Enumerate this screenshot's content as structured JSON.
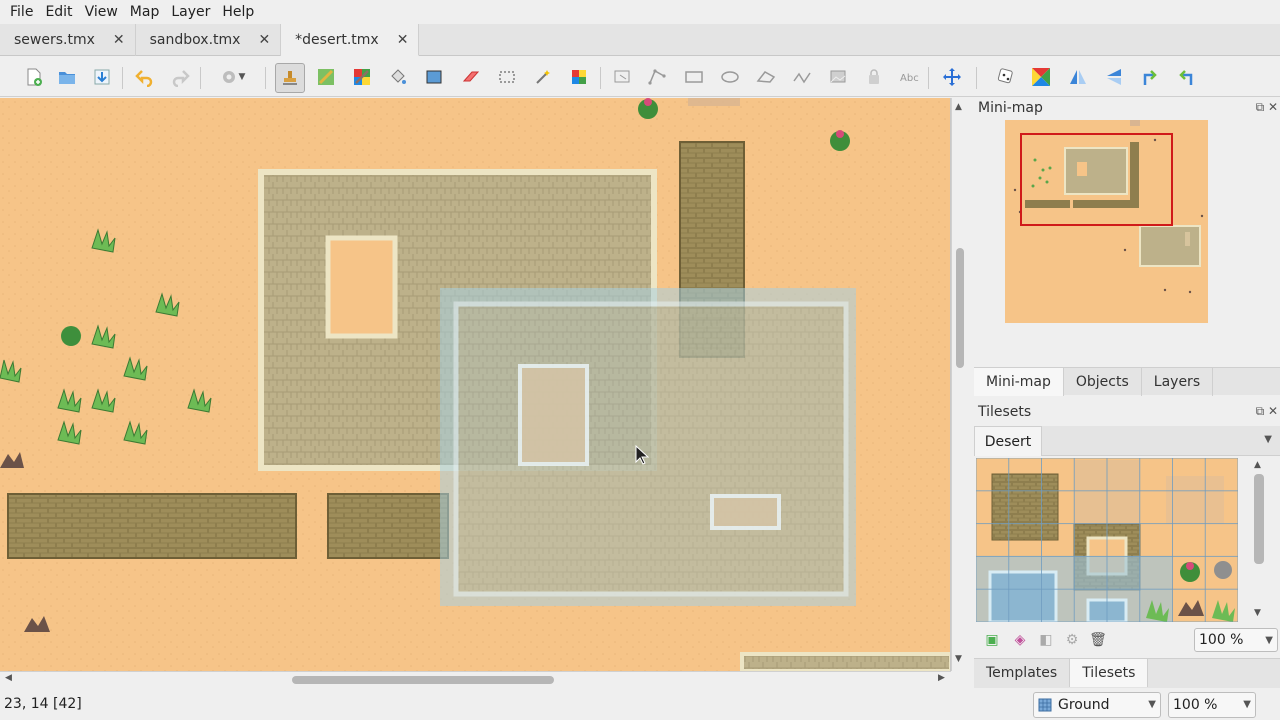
{
  "menu": [
    "File",
    "Edit",
    "View",
    "Map",
    "Layer",
    "Help"
  ],
  "tabs": [
    {
      "label": "sewers.tmx",
      "active": false
    },
    {
      "label": "sandbox.tmx",
      "active": false
    },
    {
      "label": "*desert.tmx",
      "active": true
    }
  ],
  "tab_close_glyph": "✕",
  "toolbar_icons": [
    "new-map-icon",
    "open-icon",
    "save-icon",
    "undo-icon",
    "redo-icon",
    "command-icon",
    "stamp-brush-icon",
    "terrain-brush-icon",
    "wang-brush-icon",
    "bucket-fill-icon",
    "shape-fill-icon",
    "eraser-icon",
    "rect-select-icon",
    "magic-wand-icon",
    "select-same-tile-icon",
    "select-objects-icon",
    "edit-polygons-icon",
    "insert-rectangle-icon",
    "insert-ellipse-icon",
    "insert-polygon-icon",
    "insert-polyline-icon",
    "insert-tile-icon",
    "insert-template-icon",
    "insert-text-icon",
    "move-icon",
    "random-mode-icon",
    "wang-fill-mode-icon",
    "flip-horizontal-icon",
    "flip-vertical-icon",
    "rotate-left-icon",
    "rotate-right-icon"
  ],
  "status": {
    "coords": "23, 14 [42]",
    "layer": "Ground",
    "zoom": "100 %"
  },
  "minimap": {
    "title": "Mini-map"
  },
  "dock_tabs_top": [
    {
      "label": "Mini-map",
      "active": true
    },
    {
      "label": "Objects",
      "active": false
    },
    {
      "label": "Layers",
      "active": false
    }
  ],
  "tilesets": {
    "title": "Tilesets",
    "tab": "Desert",
    "zoom": "100 %"
  },
  "dock_tabs_bottom": [
    {
      "label": "Templates",
      "active": false
    },
    {
      "label": "Tilesets",
      "active": true
    }
  ],
  "colors": {
    "sand": "#f6c488",
    "stone_floor": "#c2b58e",
    "stone_border": "#ede5c4",
    "brick": "#8c7c4c",
    "selection_overlay": "#a8cfe0",
    "minimap_viewport": "#d01a1a"
  }
}
